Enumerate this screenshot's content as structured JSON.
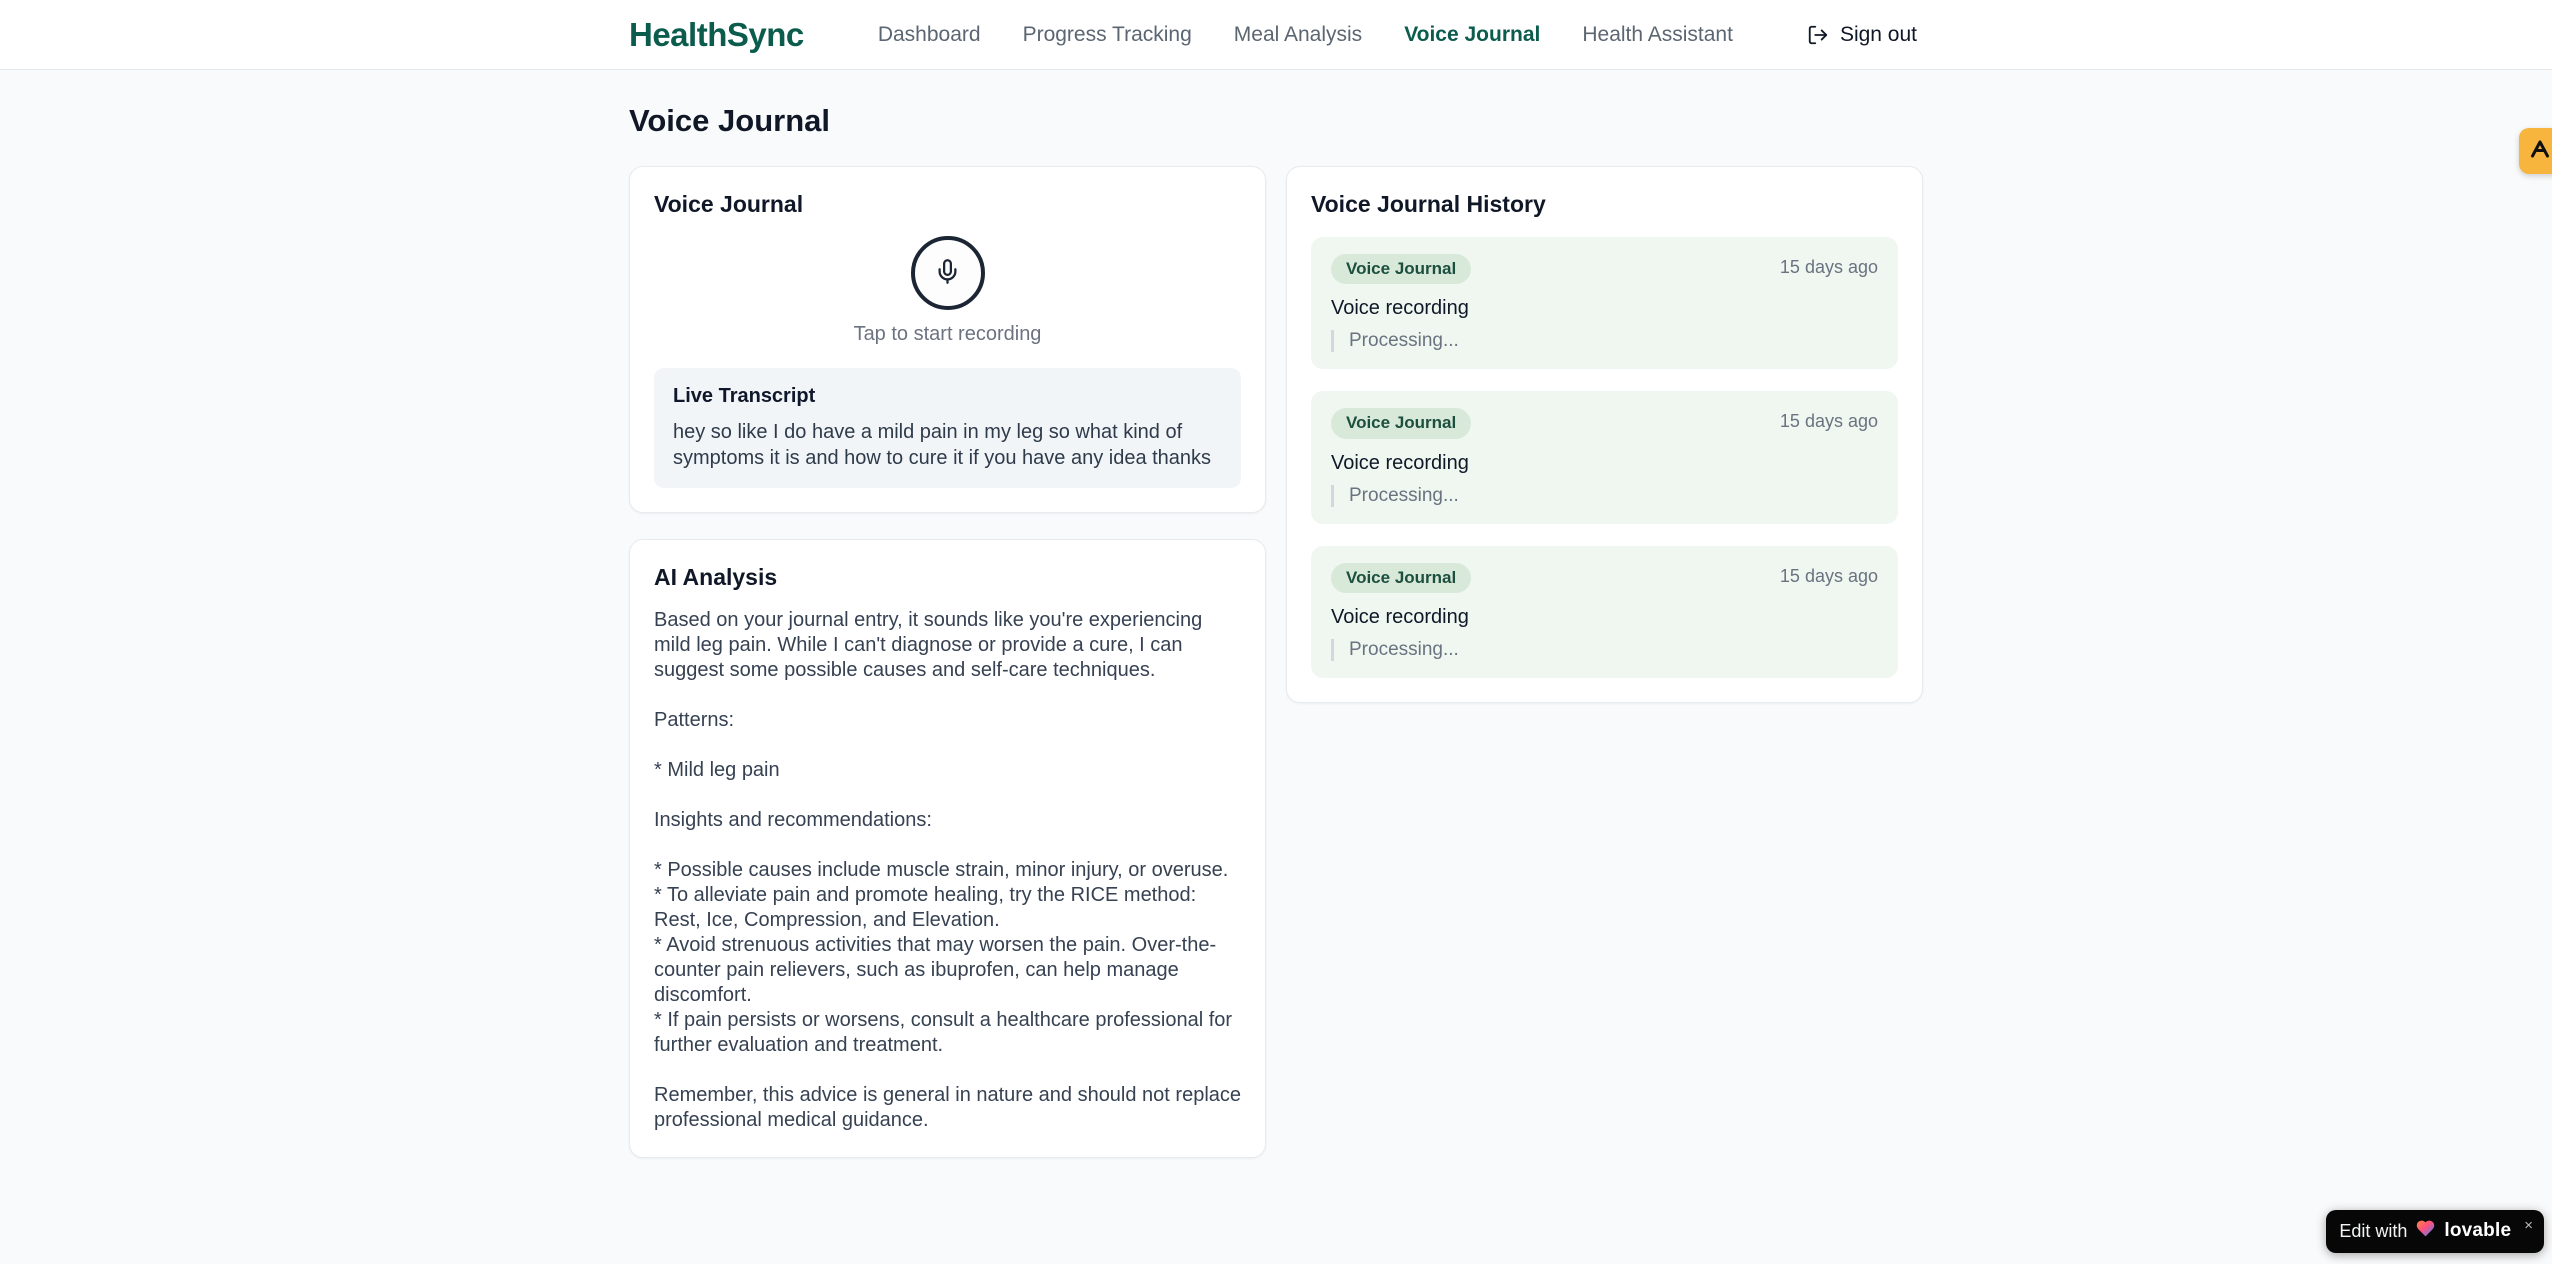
{
  "header": {
    "brand": "HealthSync",
    "nav": [
      {
        "label": "Dashboard",
        "active": false
      },
      {
        "label": "Progress Tracking",
        "active": false
      },
      {
        "label": "Meal Analysis",
        "active": false
      },
      {
        "label": "Voice Journal",
        "active": true
      },
      {
        "label": "Health Assistant",
        "active": false
      }
    ],
    "sign_out_label": "Sign out",
    "sign_out_icon": "logout-icon"
  },
  "page": {
    "title": "Voice Journal"
  },
  "recorder_card": {
    "title": "Voice Journal",
    "mic_icon": "microphone-icon",
    "tap_hint": "Tap to start recording",
    "transcript_title": "Live Transcript",
    "transcript_text": "hey so like I do have a mild pain in my leg so what kind of symptoms it is and how to cure it if you have any idea thanks"
  },
  "analysis_card": {
    "title": "AI Analysis",
    "body": "Based on your journal entry, it sounds like you're experiencing mild leg pain. While I can't diagnose or provide a cure, I can suggest some possible causes and self-care techniques.\n\nPatterns:\n\n* Mild leg pain\n\nInsights and recommendations:\n\n* Possible causes include muscle strain, minor injury, or overuse.\n* To alleviate pain and promote healing, try the RICE method: Rest, Ice, Compression, and Elevation.\n* Avoid strenuous activities that may worsen the pain. Over-the-counter pain relievers, such as ibuprofen, can help manage discomfort.\n* If pain persists or worsens, consult a healthcare professional for further evaluation and treatment.\n\nRemember, this advice is general in nature and should not replace professional medical guidance."
  },
  "history_card": {
    "title": "Voice Journal History",
    "entries": [
      {
        "badge": "Voice Journal",
        "time": "15 days ago",
        "title": "Voice recording",
        "status": "Processing..."
      },
      {
        "badge": "Voice Journal",
        "time": "15 days ago",
        "title": "Voice recording",
        "status": "Processing..."
      },
      {
        "badge": "Voice Journal",
        "time": "15 days ago",
        "title": "Voice recording",
        "status": "Processing..."
      }
    ]
  },
  "floating": {
    "side_button_icon": "a-logo-icon",
    "edit_badge": {
      "prefix": "Edit with",
      "heart_icon": "heart-gradient-icon",
      "brand": "lovable",
      "close": "×"
    }
  },
  "colors": {
    "brand_green": "#0c5c4e",
    "page_background": "#f9fafb",
    "card_border": "#e7eaee",
    "entry_background": "#eff7f0",
    "badge_background": "#d8e9da",
    "badge_text": "#1d4f3f",
    "muted_text": "#6b7280",
    "amber_button": "#f7b53d",
    "lovable_badge_background": "#070707"
  }
}
